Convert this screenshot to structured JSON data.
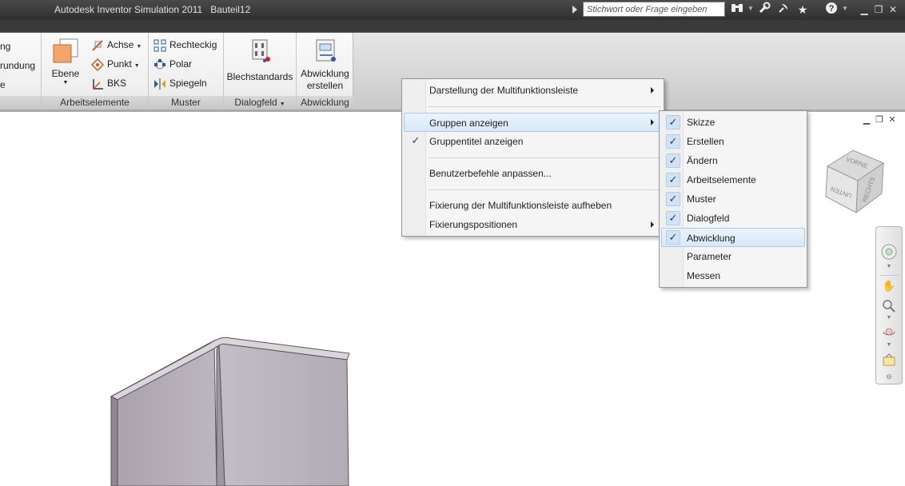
{
  "titlebar": {
    "app_title": "Autodesk Inventor Simulation 2011",
    "document": "Bauteil12",
    "search_placeholder": "Stichwort oder Frage eingeben",
    "icons": [
      "binoculars-icon",
      "wrench-icon",
      "satellite-icon",
      "star-icon",
      "help-icon"
    ]
  },
  "ribbon": {
    "left_cut_items": [
      "ng",
      "rundung",
      "e"
    ],
    "arbeitselemente": {
      "label": "Arbeitselemente",
      "ebene": "Ebene",
      "achse": "Achse",
      "punkt": "Punkt",
      "bks": "BKS"
    },
    "muster": {
      "label": "Muster",
      "rechteckig": "Rechteckig",
      "polar": "Polar",
      "spiegeln": "Spiegeln"
    },
    "dialogfeld": {
      "label": "Dialogfeld",
      "blechstandards": "Blechstandards"
    },
    "abwicklung": {
      "label": "Abwicklung",
      "button_line1": "Abwicklung",
      "button_line2": "erstellen"
    }
  },
  "context_menu": {
    "items": [
      {
        "label": "Darstellung der Multifunktionsleiste",
        "submenu": true
      },
      {
        "label": "Gruppen anzeigen",
        "submenu": true,
        "highlighted": true
      },
      {
        "label": "Gruppentitel anzeigen",
        "checked": true
      },
      {
        "label": "Benutzerbefehle anpassen..."
      },
      {
        "label": "Fixierung der Multifunktionsleiste aufheben"
      },
      {
        "label": "Fixierungspositionen",
        "submenu": true
      }
    ]
  },
  "submenu": {
    "items": [
      {
        "label": "Skizze",
        "checked": true
      },
      {
        "label": "Erstellen",
        "checked": true
      },
      {
        "label": "Ändern",
        "checked": true
      },
      {
        "label": "Arbeitselemente",
        "checked": true
      },
      {
        "label": "Muster",
        "checked": true
      },
      {
        "label": "Dialogfeld",
        "checked": true
      },
      {
        "label": "Abwicklung",
        "checked": true,
        "highlighted": true
      },
      {
        "label": "Parameter",
        "checked": false
      },
      {
        "label": "Messen",
        "checked": false
      }
    ]
  },
  "viewcube": {
    "face_front": "VORNE",
    "face_right": "RECHTS",
    "face_bottom": "UNTEN"
  },
  "colors": {
    "titlebar": "#3a3a3a",
    "menu_highlight": "#d8e8f8",
    "check_bg": "#d2e3f6",
    "part_face": "#b7b0bb"
  }
}
